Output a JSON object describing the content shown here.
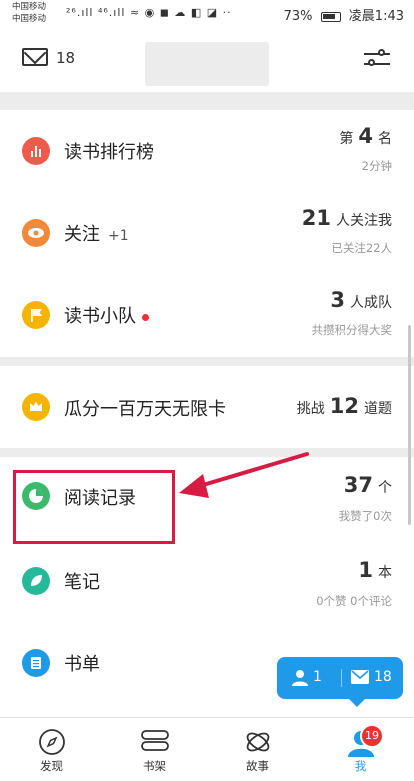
{
  "status_bar": {
    "carrier_1": "中国移动",
    "carrier_2": "中国移动",
    "icons_text": "²⁶.ıll ⁴⁶.ıll ≈ ◉ ◼ ☁ ◧ ◪ ··",
    "battery": "73%",
    "time": "凌晨1:43"
  },
  "header": {
    "mail_count": "18"
  },
  "rows": {
    "rank": {
      "label": "读书排行榜",
      "prefix": "第",
      "value": "4",
      "suffix": "名",
      "sub": "2分钟",
      "icon_color": "#ee5b4d"
    },
    "follow": {
      "label": "关注",
      "plus": "+1",
      "value": "21",
      "suffix": "人关注我",
      "sub": "已关注22人",
      "icon_color": "#f08a3a"
    },
    "team": {
      "label": "读书小队",
      "value": "3",
      "suffix": "人成队",
      "sub": "共攒积分得大奖",
      "icon_color": "#f5b400"
    },
    "card": {
      "label": "瓜分一百万天无限卡",
      "prefix": "挑战",
      "value": "12",
      "suffix": "道题",
      "icon_color": "#f5b400"
    },
    "records": {
      "label": "阅读记录",
      "value": "37",
      "suffix": "个",
      "sub": "我赞了0次",
      "icon_color": "#3cba6b"
    },
    "notes": {
      "label": "笔记",
      "value": "1",
      "suffix": "本",
      "sub": "0个赞 0个评论",
      "icon_color": "#25b99a"
    },
    "booklist": {
      "label": "书单",
      "icon_color": "#1e9ae8"
    }
  },
  "float_pill": {
    "people_count": "1",
    "mail_count": "18"
  },
  "tabbar": {
    "tabs": [
      "发现",
      "书架",
      "故事",
      "我"
    ],
    "badge": "19",
    "active_color": "#1e9ae8"
  },
  "colors": {
    "accent": "#1e9ae8",
    "highlight_border": "#d71b43",
    "red_dot": "#e8332f"
  }
}
